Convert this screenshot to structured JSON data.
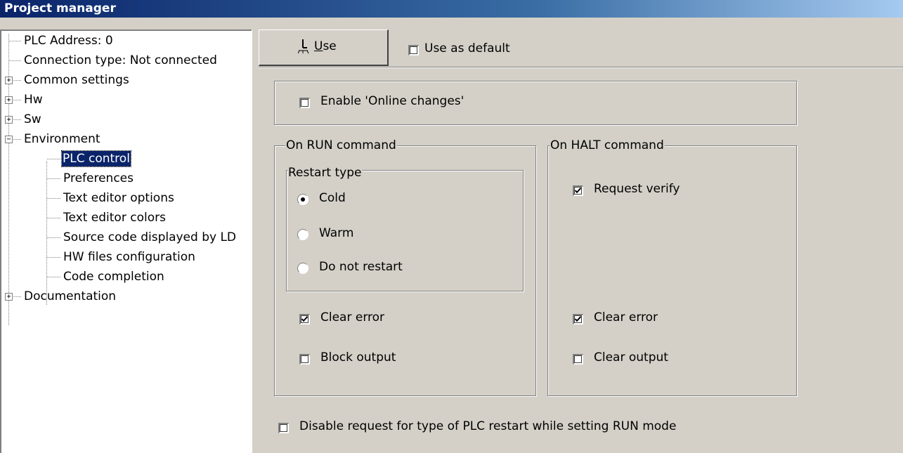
{
  "window": {
    "title": "Project manager"
  },
  "tree": {
    "items": [
      {
        "label": "PLC Address: 0"
      },
      {
        "label": "Connection type: Not connected"
      },
      {
        "label": "Common settings"
      },
      {
        "label": "Hw"
      },
      {
        "label": "Sw"
      },
      {
        "label": "Environment"
      },
      {
        "label": "PLC control"
      },
      {
        "label": "Preferences"
      },
      {
        "label": "Text editor options"
      },
      {
        "label": "Text editor colors"
      },
      {
        "label": "Source code displayed by LD"
      },
      {
        "label": "HW files configuration"
      },
      {
        "label": "Code completion"
      },
      {
        "label": "Documentation"
      }
    ],
    "expander_plus": "+",
    "expander_minus": "−"
  },
  "toolbar": {
    "use_mnemonic": "U",
    "use_rest": "se",
    "use_as_default": "Use as default",
    "use_as_default_checked": false
  },
  "settings": {
    "enable_online_changes": {
      "label": "Enable 'Online changes'",
      "checked": false
    },
    "run_group": {
      "title": "On RUN command",
      "restart_title": "Restart type",
      "options": [
        "Cold",
        "Warm",
        "Do not restart"
      ],
      "selected": "Cold",
      "clear_error": {
        "label": "Clear error",
        "checked": true
      },
      "block_output": {
        "label": "Block output",
        "checked": false
      }
    },
    "halt_group": {
      "title": "On HALT command",
      "request_verify": {
        "label": "Request verify",
        "checked": true
      },
      "clear_error": {
        "label": "Clear error",
        "checked": true
      },
      "clear_output": {
        "label": "Clear output",
        "checked": false
      }
    },
    "disable_restart_request": {
      "label": "Disable request for type of PLC restart while setting RUN mode",
      "checked": false
    }
  }
}
